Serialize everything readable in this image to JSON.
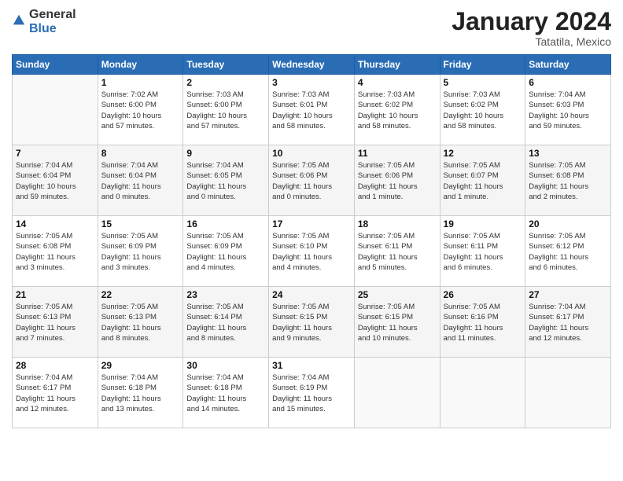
{
  "header": {
    "logo_general": "General",
    "logo_blue": "Blue",
    "month_year": "January 2024",
    "location": "Tatatila, Mexico"
  },
  "days_of_week": [
    "Sunday",
    "Monday",
    "Tuesday",
    "Wednesday",
    "Thursday",
    "Friday",
    "Saturday"
  ],
  "weeks": [
    [
      {
        "day": "",
        "info": ""
      },
      {
        "day": "1",
        "info": "Sunrise: 7:02 AM\nSunset: 6:00 PM\nDaylight: 10 hours\nand 57 minutes."
      },
      {
        "day": "2",
        "info": "Sunrise: 7:03 AM\nSunset: 6:00 PM\nDaylight: 10 hours\nand 57 minutes."
      },
      {
        "day": "3",
        "info": "Sunrise: 7:03 AM\nSunset: 6:01 PM\nDaylight: 10 hours\nand 58 minutes."
      },
      {
        "day": "4",
        "info": "Sunrise: 7:03 AM\nSunset: 6:02 PM\nDaylight: 10 hours\nand 58 minutes."
      },
      {
        "day": "5",
        "info": "Sunrise: 7:03 AM\nSunset: 6:02 PM\nDaylight: 10 hours\nand 58 minutes."
      },
      {
        "day": "6",
        "info": "Sunrise: 7:04 AM\nSunset: 6:03 PM\nDaylight: 10 hours\nand 59 minutes."
      }
    ],
    [
      {
        "day": "7",
        "info": "Sunrise: 7:04 AM\nSunset: 6:04 PM\nDaylight: 10 hours\nand 59 minutes."
      },
      {
        "day": "8",
        "info": "Sunrise: 7:04 AM\nSunset: 6:04 PM\nDaylight: 11 hours\nand 0 minutes."
      },
      {
        "day": "9",
        "info": "Sunrise: 7:04 AM\nSunset: 6:05 PM\nDaylight: 11 hours\nand 0 minutes."
      },
      {
        "day": "10",
        "info": "Sunrise: 7:05 AM\nSunset: 6:06 PM\nDaylight: 11 hours\nand 0 minutes."
      },
      {
        "day": "11",
        "info": "Sunrise: 7:05 AM\nSunset: 6:06 PM\nDaylight: 11 hours\nand 1 minute."
      },
      {
        "day": "12",
        "info": "Sunrise: 7:05 AM\nSunset: 6:07 PM\nDaylight: 11 hours\nand 1 minute."
      },
      {
        "day": "13",
        "info": "Sunrise: 7:05 AM\nSunset: 6:08 PM\nDaylight: 11 hours\nand 2 minutes."
      }
    ],
    [
      {
        "day": "14",
        "info": "Sunrise: 7:05 AM\nSunset: 6:08 PM\nDaylight: 11 hours\nand 3 minutes."
      },
      {
        "day": "15",
        "info": "Sunrise: 7:05 AM\nSunset: 6:09 PM\nDaylight: 11 hours\nand 3 minutes."
      },
      {
        "day": "16",
        "info": "Sunrise: 7:05 AM\nSunset: 6:09 PM\nDaylight: 11 hours\nand 4 minutes."
      },
      {
        "day": "17",
        "info": "Sunrise: 7:05 AM\nSunset: 6:10 PM\nDaylight: 11 hours\nand 4 minutes."
      },
      {
        "day": "18",
        "info": "Sunrise: 7:05 AM\nSunset: 6:11 PM\nDaylight: 11 hours\nand 5 minutes."
      },
      {
        "day": "19",
        "info": "Sunrise: 7:05 AM\nSunset: 6:11 PM\nDaylight: 11 hours\nand 6 minutes."
      },
      {
        "day": "20",
        "info": "Sunrise: 7:05 AM\nSunset: 6:12 PM\nDaylight: 11 hours\nand 6 minutes."
      }
    ],
    [
      {
        "day": "21",
        "info": "Sunrise: 7:05 AM\nSunset: 6:13 PM\nDaylight: 11 hours\nand 7 minutes."
      },
      {
        "day": "22",
        "info": "Sunrise: 7:05 AM\nSunset: 6:13 PM\nDaylight: 11 hours\nand 8 minutes."
      },
      {
        "day": "23",
        "info": "Sunrise: 7:05 AM\nSunset: 6:14 PM\nDaylight: 11 hours\nand 8 minutes."
      },
      {
        "day": "24",
        "info": "Sunrise: 7:05 AM\nSunset: 6:15 PM\nDaylight: 11 hours\nand 9 minutes."
      },
      {
        "day": "25",
        "info": "Sunrise: 7:05 AM\nSunset: 6:15 PM\nDaylight: 11 hours\nand 10 minutes."
      },
      {
        "day": "26",
        "info": "Sunrise: 7:05 AM\nSunset: 6:16 PM\nDaylight: 11 hours\nand 11 minutes."
      },
      {
        "day": "27",
        "info": "Sunrise: 7:04 AM\nSunset: 6:17 PM\nDaylight: 11 hours\nand 12 minutes."
      }
    ],
    [
      {
        "day": "28",
        "info": "Sunrise: 7:04 AM\nSunset: 6:17 PM\nDaylight: 11 hours\nand 12 minutes."
      },
      {
        "day": "29",
        "info": "Sunrise: 7:04 AM\nSunset: 6:18 PM\nDaylight: 11 hours\nand 13 minutes."
      },
      {
        "day": "30",
        "info": "Sunrise: 7:04 AM\nSunset: 6:18 PM\nDaylight: 11 hours\nand 14 minutes."
      },
      {
        "day": "31",
        "info": "Sunrise: 7:04 AM\nSunset: 6:19 PM\nDaylight: 11 hours\nand 15 minutes."
      },
      {
        "day": "",
        "info": ""
      },
      {
        "day": "",
        "info": ""
      },
      {
        "day": "",
        "info": ""
      }
    ]
  ]
}
